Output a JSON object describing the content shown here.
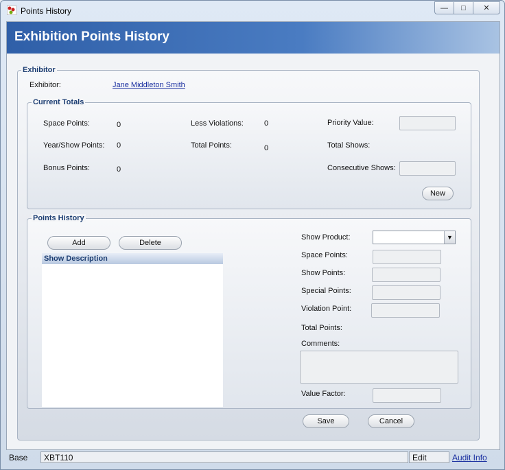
{
  "window": {
    "title": "Points History",
    "controls": {
      "minimize": "—",
      "maximize": "□",
      "close": "✕"
    }
  },
  "header": {
    "title": "Exhibition Points History"
  },
  "exhibitor_section": {
    "legend": "Exhibitor",
    "label": "Exhibitor:",
    "name": "Jane Middleton Smith"
  },
  "current_totals": {
    "legend": "Current Totals",
    "space_points_label": "Space Points:",
    "space_points_value": "0",
    "year_show_points_label": "Year/Show Points:",
    "year_show_points_value": "0",
    "bonus_points_label": "Bonus Points:",
    "bonus_points_value": "0",
    "less_violations_label": "Less Violations:",
    "less_violations_value": "0",
    "total_points_label": "Total Points:",
    "total_points_value": "0",
    "priority_value_label": "Priority Value:",
    "total_shows_label": "Total Shows:",
    "consecutive_shows_label": "Consecutive Shows:",
    "new_button": "New"
  },
  "points_history": {
    "legend": "Points History",
    "add_button": "Add",
    "delete_button": "Delete",
    "list_header": "Show Description",
    "show_product_label": "Show Product:",
    "space_points_label": "Space Points:",
    "show_points_label": "Show Points:",
    "special_points_label": "Special Points:",
    "violation_point_label": "Violation Point:",
    "total_points_label": "Total Points:",
    "comments_label": "Comments:",
    "value_factor_label": "Value Factor:"
  },
  "footer": {
    "save_button": "Save",
    "cancel_button": "Cancel"
  },
  "statusbar": {
    "base": "Base",
    "code": "XBT110",
    "mode": "Edit",
    "audit_info": "Audit Info"
  },
  "colors": {
    "header_blue": "#2f5fa8",
    "legend_text": "#1e3f73",
    "link": "#1a2fa0"
  }
}
